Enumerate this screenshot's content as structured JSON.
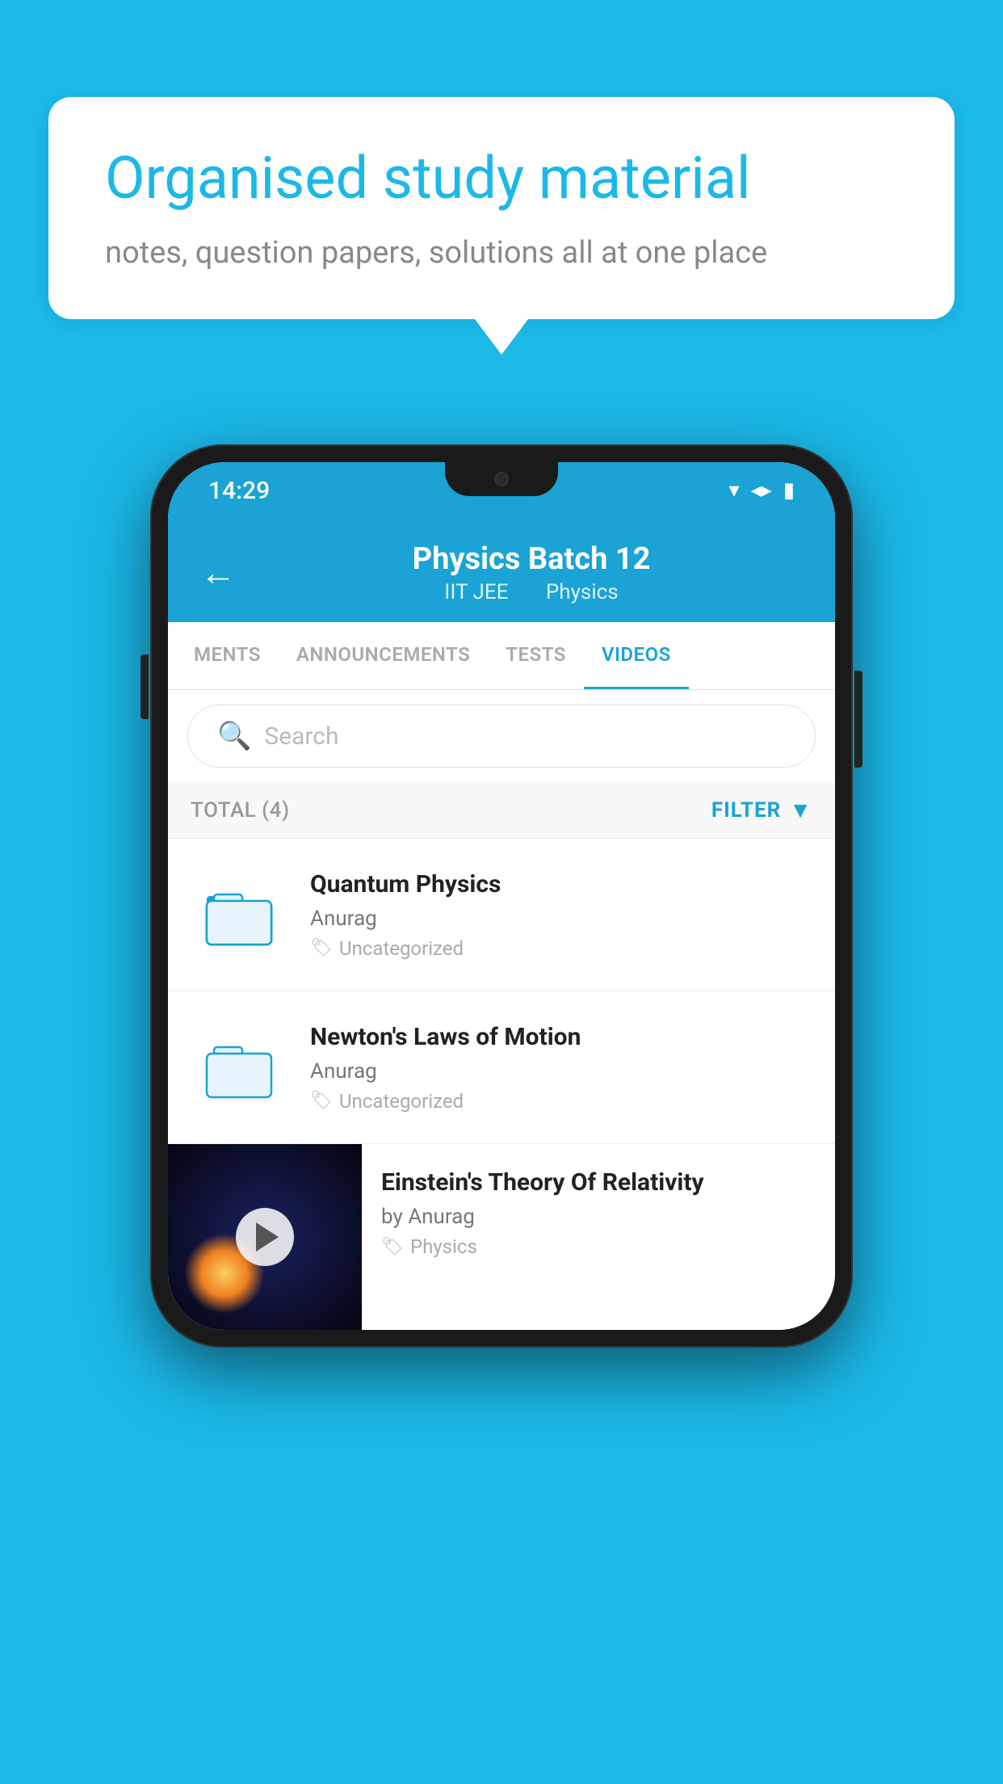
{
  "background_color": "#1BB8E8",
  "promo": {
    "title": "Organised study material",
    "subtitle": "notes, question papers, solutions all at one place"
  },
  "phone": {
    "status_bar": {
      "time": "14:29",
      "icons": [
        "wifi",
        "signal",
        "battery"
      ]
    },
    "header": {
      "back_label": "←",
      "title": "Physics Batch 12",
      "subtitle_part1": "IIT JEE",
      "subtitle_part2": "Physics"
    },
    "tabs": [
      {
        "label": "MENTS",
        "active": false
      },
      {
        "label": "ANNOUNCEMENTS",
        "active": false
      },
      {
        "label": "TESTS",
        "active": false
      },
      {
        "label": "VIDEOS",
        "active": true
      }
    ],
    "search": {
      "placeholder": "Search"
    },
    "filter_bar": {
      "total_label": "TOTAL (4)",
      "filter_label": "FILTER"
    },
    "videos": [
      {
        "title": "Quantum Physics",
        "author": "Anurag",
        "tag": "Uncategorized",
        "type": "folder"
      },
      {
        "title": "Newton's Laws of Motion",
        "author": "Anurag",
        "tag": "Uncategorized",
        "type": "folder"
      },
      {
        "title": "Einstein's Theory Of Relativity",
        "author": "by Anurag",
        "tag": "Physics",
        "type": "video"
      }
    ]
  }
}
